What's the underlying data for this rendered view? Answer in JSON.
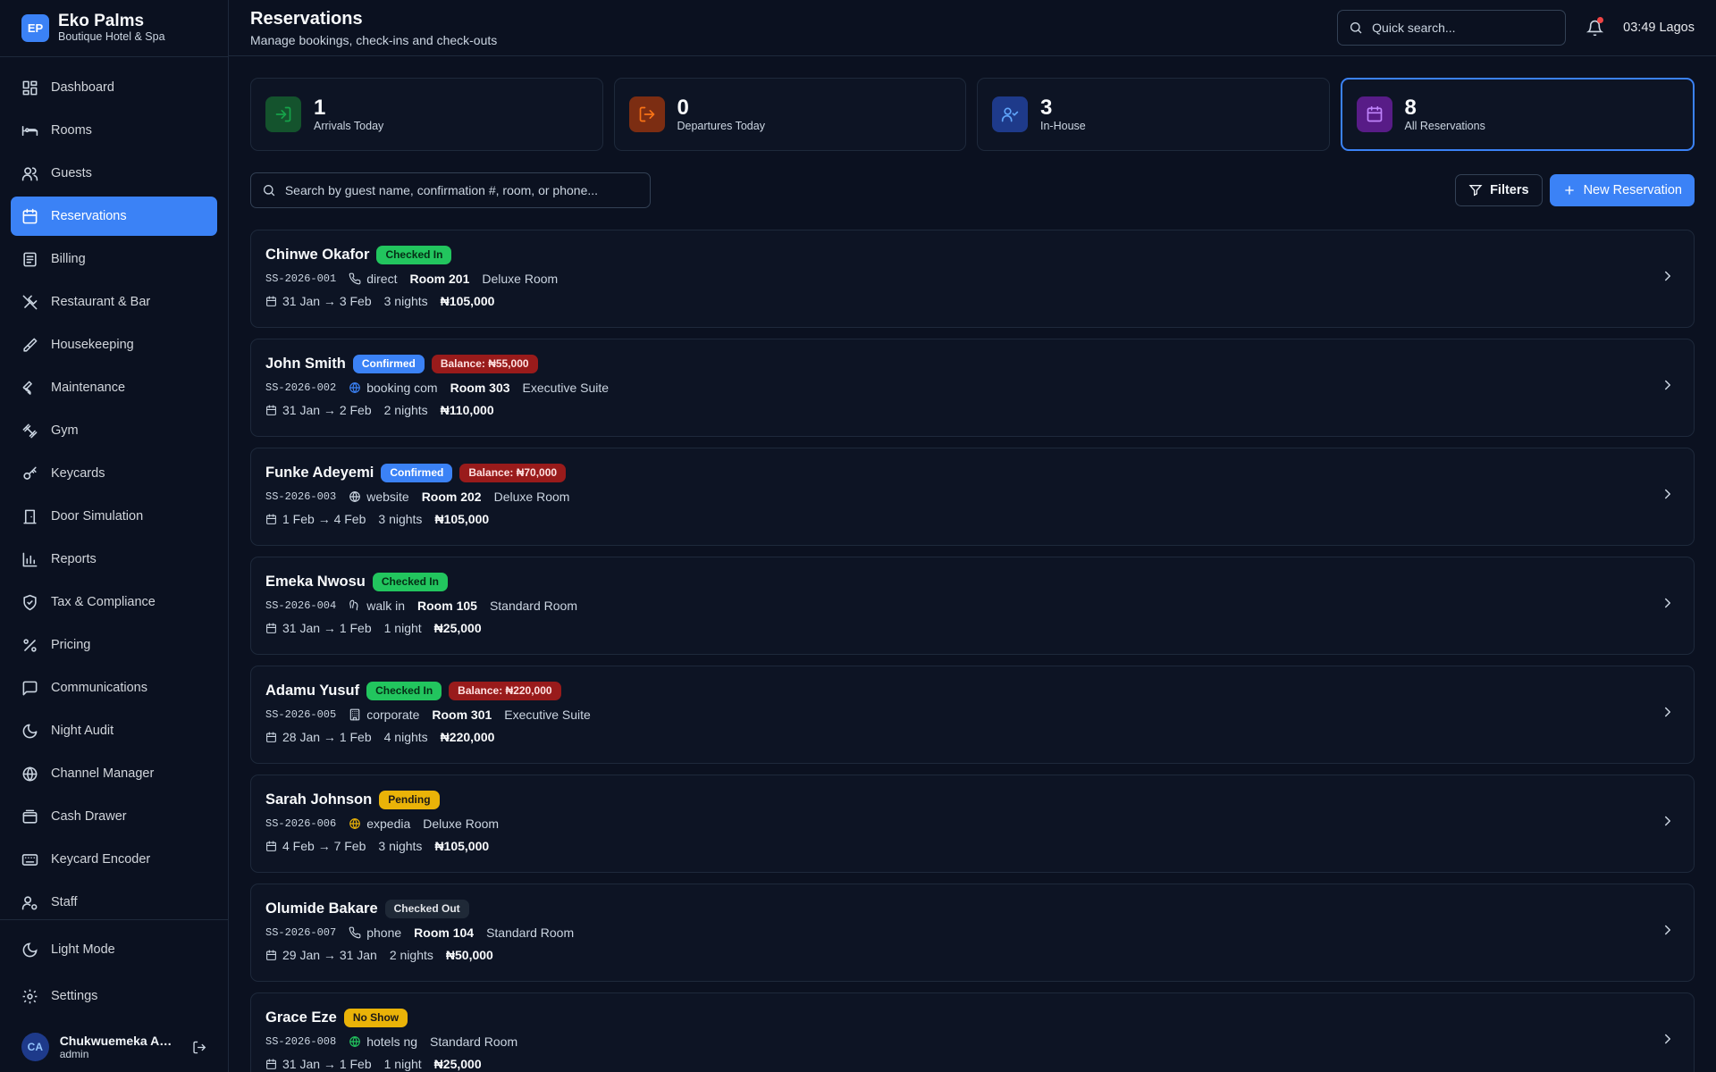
{
  "brand": {
    "initials": "EP",
    "name": "Eko Palms",
    "subtitle": "Boutique Hotel & Spa"
  },
  "nav": [
    {
      "label": "Dashboard",
      "icon": "dashboard-icon",
      "active": false
    },
    {
      "label": "Rooms",
      "icon": "bed-icon",
      "active": false
    },
    {
      "label": "Guests",
      "icon": "users-icon",
      "active": false
    },
    {
      "label": "Reservations",
      "icon": "calendar-icon",
      "active": true
    },
    {
      "label": "Billing",
      "icon": "receipt-icon",
      "active": false
    },
    {
      "label": "Restaurant & Bar",
      "icon": "utensils-icon",
      "active": false
    },
    {
      "label": "Housekeeping",
      "icon": "brush-icon",
      "active": false
    },
    {
      "label": "Maintenance",
      "icon": "wrench-icon",
      "active": false
    },
    {
      "label": "Gym",
      "icon": "dumbbell-icon",
      "active": false
    },
    {
      "label": "Keycards",
      "icon": "key-icon",
      "active": false
    },
    {
      "label": "Door Simulation",
      "icon": "door-icon",
      "active": false
    },
    {
      "label": "Reports",
      "icon": "bar-chart-icon",
      "active": false
    },
    {
      "label": "Tax & Compliance",
      "icon": "shield-icon",
      "active": false
    },
    {
      "label": "Pricing",
      "icon": "percent-icon",
      "active": false
    },
    {
      "label": "Communications",
      "icon": "message-icon",
      "active": false
    },
    {
      "label": "Night Audit",
      "icon": "moon-icon",
      "active": false
    },
    {
      "label": "Channel Manager",
      "icon": "globe-icon",
      "active": false
    },
    {
      "label": "Cash Drawer",
      "icon": "wallet-icon",
      "active": false
    },
    {
      "label": "Keycard Encoder",
      "icon": "keyboard-icon",
      "active": false
    },
    {
      "label": "Staff",
      "icon": "user-cog-icon",
      "active": false
    }
  ],
  "bottom": {
    "theme_label": "Light Mode",
    "settings_label": "Settings"
  },
  "user": {
    "initials": "CA",
    "name": "Chukwuemeka Adeyemi",
    "role": "admin"
  },
  "header": {
    "title": "Reservations",
    "subtitle": "Manage bookings, check-ins and check-outs",
    "search_placeholder": "Quick search...",
    "clock": "03:49 Lagos"
  },
  "stats": [
    {
      "value": "1",
      "label": "Arrivals Today",
      "color": "#16a34a",
      "bg": "#14532d",
      "icon": "arrival-icon"
    },
    {
      "value": "0",
      "label": "Departures Today",
      "color": "#f97316",
      "bg": "#7c2d12",
      "icon": "departure-icon"
    },
    {
      "value": "3",
      "label": "In-House",
      "color": "#60a5fa",
      "bg": "#1e3a8a",
      "icon": "user-check-icon"
    },
    {
      "value": "8",
      "label": "All Reservations",
      "color": "#c084fc",
      "bg": "#581c87",
      "icon": "calendar-icon"
    }
  ],
  "toolbar": {
    "search_placeholder": "Search by guest name, confirmation #, room, or phone...",
    "filters_label": "Filters",
    "new_label": "New Reservation"
  },
  "reservations": [
    {
      "guest": "Chinwe Okafor",
      "status": "Checked In",
      "status_class": "b-green",
      "balance": "",
      "conf": "SS-2026-001",
      "source": "direct",
      "source_icon": "phone-icon",
      "room": "Room 201",
      "room_type": "Deluxe Room",
      "dates": "31 Jan → 3 Feb",
      "nights": "3 nights",
      "amount": "₦105,000"
    },
    {
      "guest": "John Smith",
      "status": "Confirmed",
      "status_class": "b-blue",
      "balance": "Balance: ₦55,000",
      "conf": "SS-2026-002",
      "source": "booking com",
      "source_icon": "globe-icon",
      "room": "Room 303",
      "room_type": "Executive Suite",
      "dates": "31 Jan → 2 Feb",
      "nights": "2 nights",
      "amount": "₦110,000"
    },
    {
      "guest": "Funke Adeyemi",
      "status": "Confirmed",
      "status_class": "b-blue",
      "balance": "Balance: ₦70,000",
      "conf": "SS-2026-003",
      "source": "website",
      "source_icon": "globe-icon",
      "room": "Room 202",
      "room_type": "Deluxe Room",
      "dates": "1 Feb → 4 Feb",
      "nights": "3 nights",
      "amount": "₦105,000"
    },
    {
      "guest": "Emeka Nwosu",
      "status": "Checked In",
      "status_class": "b-green",
      "balance": "",
      "conf": "SS-2026-004",
      "source": "walk in",
      "source_icon": "footprints-icon",
      "room": "Room 105",
      "room_type": "Standard Room",
      "dates": "31 Jan → 1 Feb",
      "nights": "1 night",
      "amount": "₦25,000"
    },
    {
      "guest": "Adamu Yusuf",
      "status": "Checked In",
      "status_class": "b-green",
      "balance": "Balance: ₦220,000",
      "conf": "SS-2026-005",
      "source": "corporate",
      "source_icon": "building-icon",
      "room": "Room 301",
      "room_type": "Executive Suite",
      "dates": "28 Jan → 1 Feb",
      "nights": "4 nights",
      "amount": "₦220,000"
    },
    {
      "guest": "Sarah Johnson",
      "status": "Pending",
      "status_class": "b-yellow",
      "balance": "",
      "conf": "SS-2026-006",
      "source": "expedia",
      "source_icon": "globe-icon",
      "room": "",
      "room_type": "Deluxe Room",
      "dates": "4 Feb → 7 Feb",
      "nights": "3 nights",
      "amount": "₦105,000"
    },
    {
      "guest": "Olumide Bakare",
      "status": "Checked Out",
      "status_class": "b-gray",
      "balance": "",
      "conf": "SS-2026-007",
      "source": "phone",
      "source_icon": "phone-icon",
      "room": "Room 104",
      "room_type": "Standard Room",
      "dates": "29 Jan → 31 Jan",
      "nights": "2 nights",
      "amount": "₦50,000"
    },
    {
      "guest": "Grace Eze",
      "status": "No Show",
      "status_class": "b-yellow",
      "balance": "",
      "conf": "SS-2026-008",
      "source": "hotels ng",
      "source_icon": "globe-icon",
      "room": "",
      "room_type": "Standard Room",
      "dates": "31 Jan → 1 Feb",
      "nights": "1 night",
      "amount": "₦25,000"
    }
  ]
}
